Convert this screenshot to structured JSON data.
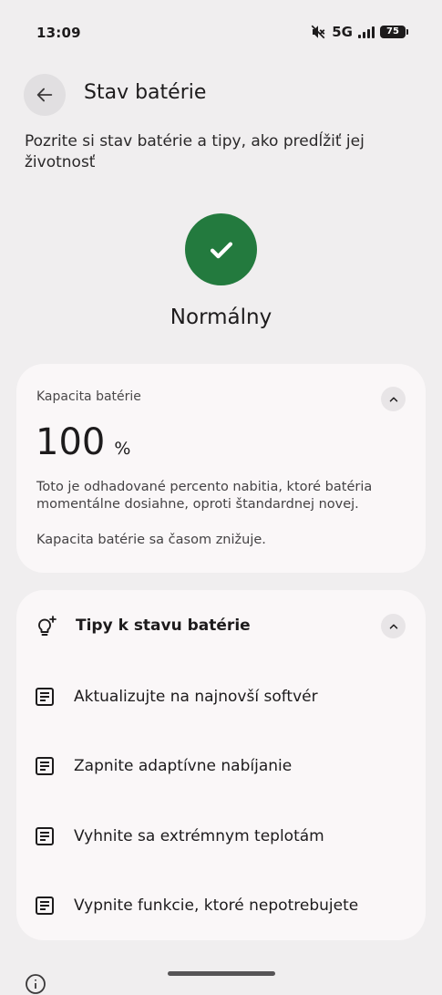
{
  "status_bar": {
    "time": "13:09",
    "network": "5G",
    "battery_level": "75"
  },
  "header": {
    "title": "Stav batérie",
    "back_icon": "arrow-left-icon"
  },
  "subtitle": "Pozrite si stav batérie a tipy, ako predĺžiť jej životnosť",
  "status": {
    "label": "Normálny",
    "icon": "check-icon",
    "color": "#237a3e"
  },
  "capacity_card": {
    "label": "Kapacita batérie",
    "value": "100",
    "unit": "%",
    "description": "Toto je odhadované percento nabitia, ktoré batéria momentálne dosiahne, oproti štandardnej novej.",
    "note": "Kapacita batérie sa časom znižuje."
  },
  "tips_card": {
    "title": "Tipy k stavu batérie",
    "tips": [
      {
        "label": "Aktualizujte na najnovší softvér"
      },
      {
        "label": "Zapnite adaptívne nabíjanie"
      },
      {
        "label": "Vyhnite sa extrémnym teplotám"
      },
      {
        "label": "Vypnite funkcie, ktoré nepotrebujete"
      }
    ]
  }
}
